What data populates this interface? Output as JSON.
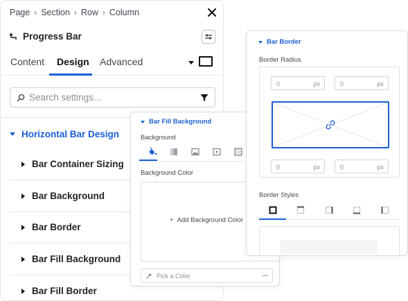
{
  "breadcrumb": {
    "items": [
      "Page",
      "Section",
      "Row",
      "Column"
    ]
  },
  "header": {
    "title": "Progress Bar"
  },
  "tabs": [
    {
      "label": "Content",
      "active": false
    },
    {
      "label": "Design",
      "active": true
    },
    {
      "label": "Advanced",
      "active": false
    }
  ],
  "search": {
    "placeholder": "Search settings..."
  },
  "section": {
    "title": "Horizontal Bar Design"
  },
  "accordion": [
    {
      "label": "Bar Container Sizing"
    },
    {
      "label": "Bar Background"
    },
    {
      "label": "Bar Border"
    },
    {
      "label": "Bar Fill Background"
    },
    {
      "label": "Bar Fill Border"
    }
  ],
  "fill_panel": {
    "title": "Bar Fill Background",
    "background_label": "Background",
    "background_types": [
      "paint-bucket-icon",
      "gradient-icon",
      "image-icon",
      "video-icon",
      "pattern-icon"
    ],
    "color_label": "Background Color",
    "add_color_label": "Add Background Color",
    "pick_placeholder": "Pick a Color"
  },
  "border_panel": {
    "title": "Bar Border",
    "radius_label": "Border Radius",
    "radius_values": [
      {
        "value": "0",
        "unit": "px"
      },
      {
        "value": "0",
        "unit": "px"
      },
      {
        "value": "0",
        "unit": "px"
      },
      {
        "value": "0",
        "unit": "px"
      }
    ],
    "styles_label": "Border Styles",
    "style_sides": [
      "all-sides-icon",
      "top-side-icon",
      "right-side-icon",
      "bottom-side-icon",
      "left-side-icon"
    ]
  },
  "colors": {
    "accent": "#1a5fd6",
    "text": "#222222",
    "muted": "#8a9099",
    "border": "#e3e6ea"
  }
}
